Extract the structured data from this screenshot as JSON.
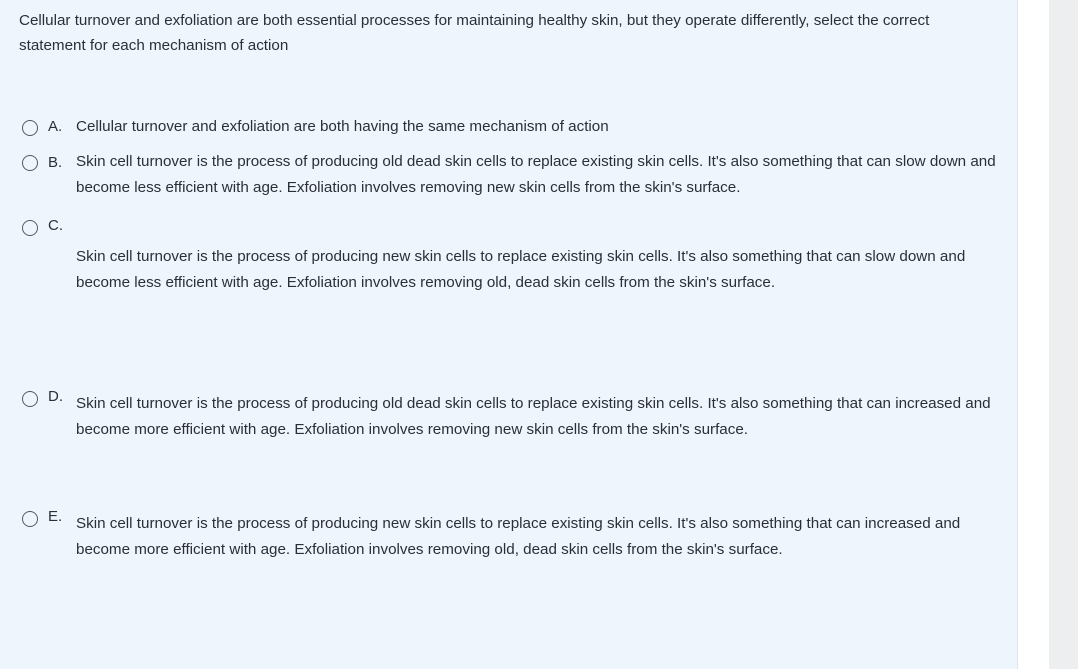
{
  "question": {
    "text": "Cellular turnover and exfoliation are both essential processes for maintaining healthy skin, but they operate differently, select the correct statement for each mechanism of action"
  },
  "options": [
    {
      "letter": "A.",
      "text": "Cellular turnover and exfoliation are both having the same mechanism of action",
      "selected": false
    },
    {
      "letter": "B.",
      "text": "Skin cell turnover is the process of producing old dead skin cells to replace existing skin cells. It's also something that can slow down and become less efficient with age. Exfoliation involves removing new skin cells from the skin's surface.",
      "selected": false
    },
    {
      "letter": "C.",
      "text": "Skin cell turnover is the process of producing new skin cells to replace existing skin cells. It's also something that can slow down and become less efficient with age. Exfoliation involves removing old, dead skin cells from the skin's surface.",
      "selected": false
    },
    {
      "letter": "D.",
      "text": "Skin cell turnover is the process of producing old dead skin cells to replace existing skin cells. It's also something that can increased and become more efficient with age. Exfoliation involves removing new skin cells from the skin's surface.",
      "selected": false
    },
    {
      "letter": "E.",
      "text": "Skin cell turnover is the process of producing new skin cells to replace existing skin cells. It's also something that can increased and become more efficient with age. Exfoliation involves removing old, dead skin cells from the skin's surface.",
      "selected": false
    }
  ],
  "colors": {
    "panel_background": "#eef5fd",
    "text": "#2b2f36",
    "radio_border": "#555a60",
    "scrollbar_track": "#eceeef"
  }
}
